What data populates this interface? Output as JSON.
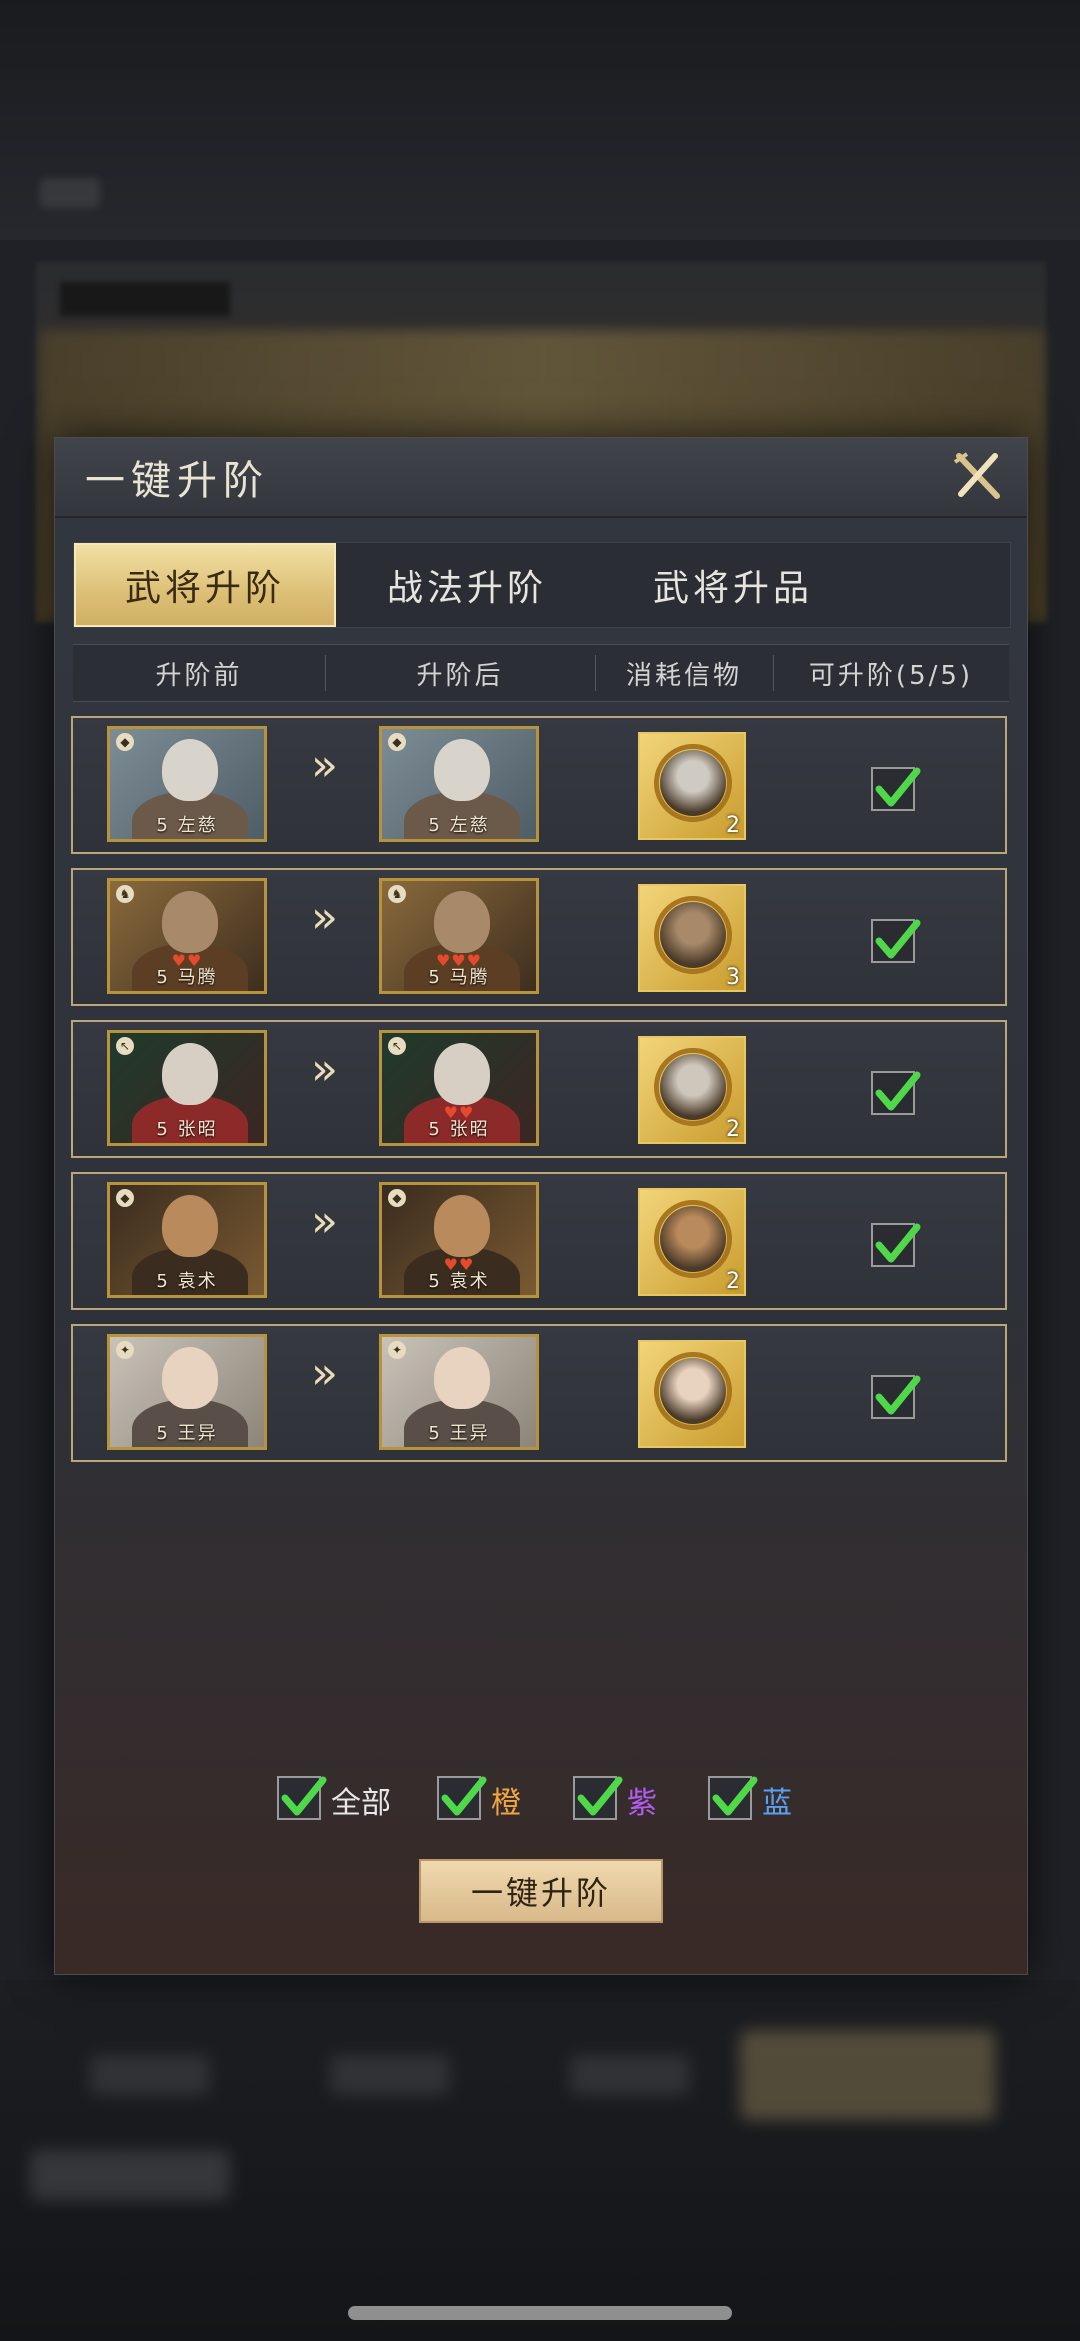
{
  "dialog": {
    "title": "一键升阶"
  },
  "tabs": [
    {
      "label": "武将升阶",
      "active": true
    },
    {
      "label": "战法升阶",
      "active": false
    },
    {
      "label": "武将升品",
      "active": false
    }
  ],
  "table": {
    "headers": [
      "升阶前",
      "升阶后",
      "消耗信物",
      "可升阶(5/5)"
    ]
  },
  "rows": [
    {
      "before": "5 左慈",
      "after": "5 左慈",
      "cost_count": "2",
      "checked": true,
      "faction_icon": "shield-icon",
      "pips_before": "",
      "pips_after": ""
    },
    {
      "before": "5 马腾",
      "after": "5 马腾",
      "cost_count": "3",
      "checked": true,
      "faction_icon": "horse-icon",
      "pips_before": "♥♥",
      "pips_after": "♥♥♥"
    },
    {
      "before": "5 张昭",
      "after": "5 张昭",
      "cost_count": "2",
      "checked": true,
      "faction_icon": "bow-icon",
      "pips_before": "",
      "pips_after": "♥♥"
    },
    {
      "before": "5 袁术",
      "after": "5 袁术",
      "cost_count": "2",
      "checked": true,
      "faction_icon": "shield-icon",
      "pips_before": "",
      "pips_after": "♥♥"
    },
    {
      "before": "5 王异",
      "after": "5 王异",
      "cost_count": "",
      "checked": true,
      "faction_icon": "spear-icon",
      "pips_before": "",
      "pips_after": ""
    }
  ],
  "filters": [
    {
      "label": "全部",
      "checked": true,
      "color": "#e8e8e8"
    },
    {
      "label": "橙",
      "checked": true,
      "color": "#f0a640"
    },
    {
      "label": "紫",
      "checked": true,
      "color": "#b45cf0"
    },
    {
      "label": "蓝",
      "checked": true,
      "color": "#5aa0f0"
    }
  ],
  "action_button": {
    "label": "一键升阶"
  },
  "colors": {
    "accent_gold": "#dcbf76",
    "row_border": "#b9a679",
    "check_green": "#4fd84a"
  }
}
